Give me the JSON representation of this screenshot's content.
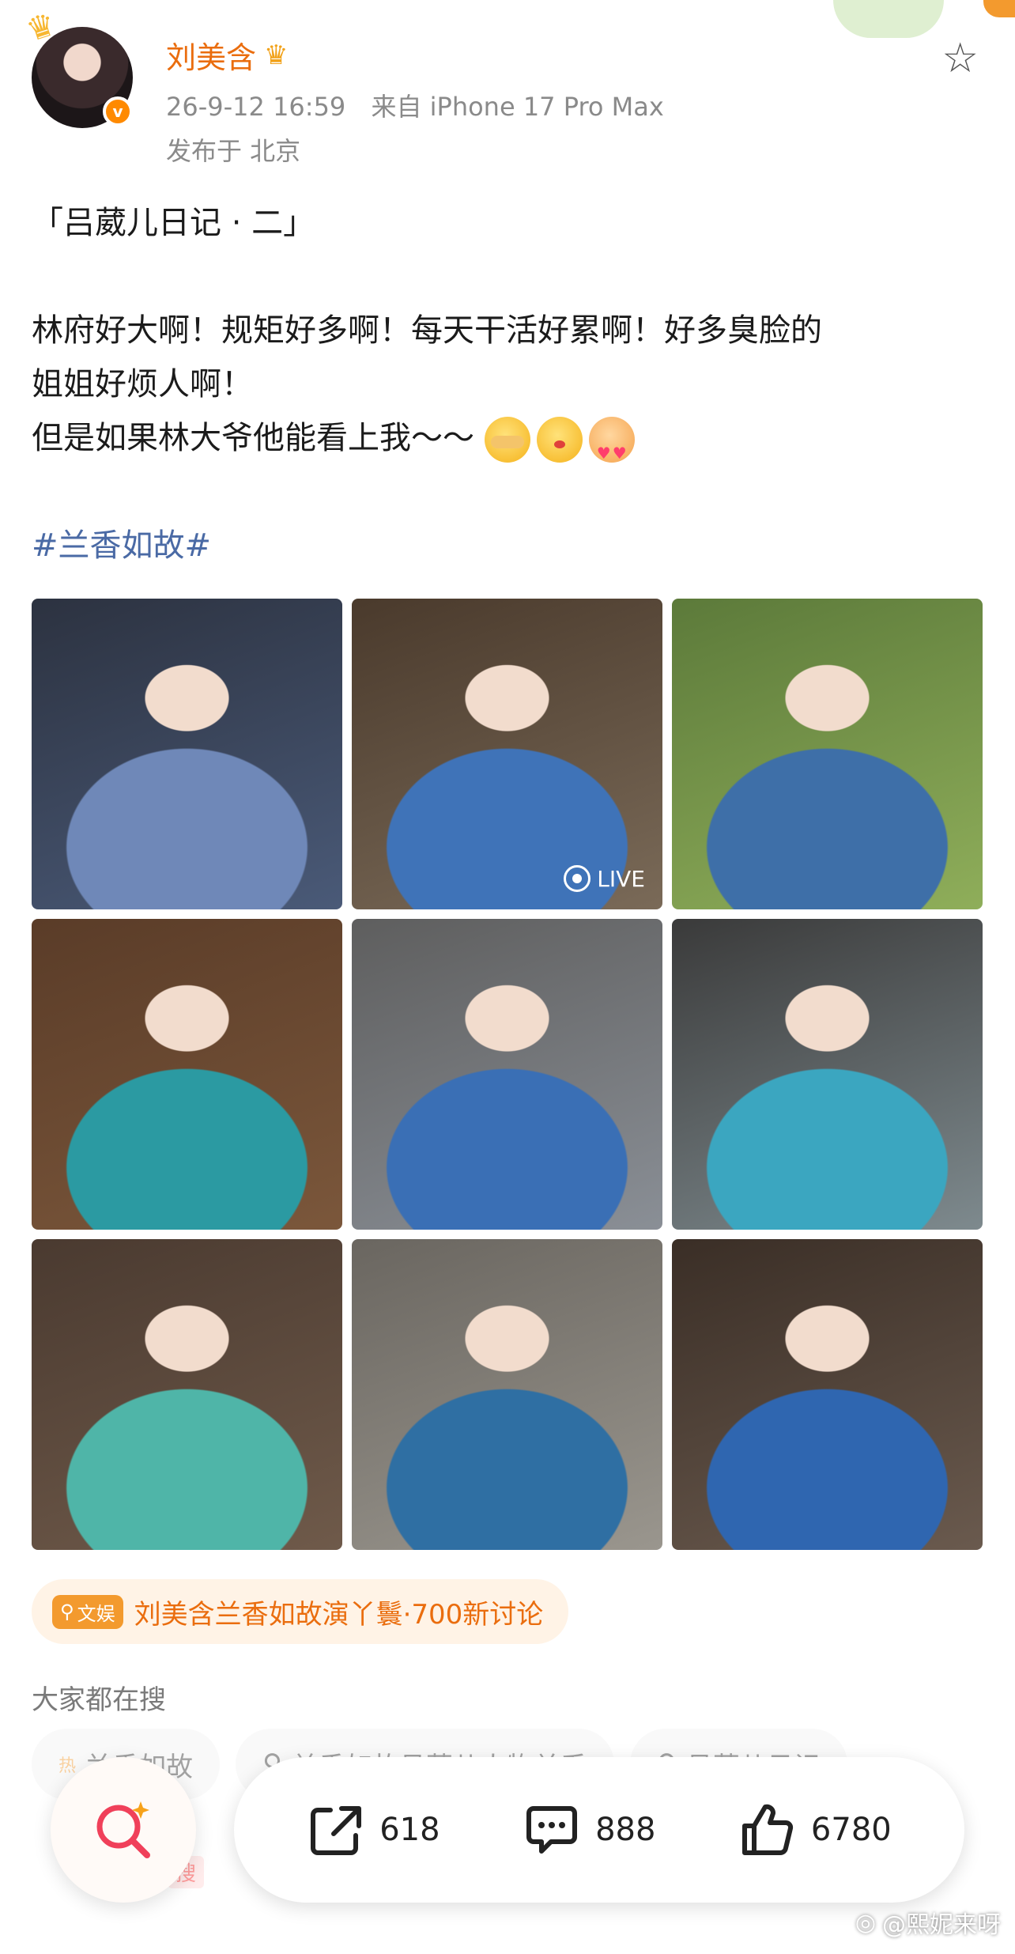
{
  "header": {
    "username": "刘美含",
    "date": "26-9-12 16:59",
    "source": "来自 iPhone 17 Pro Max",
    "location": "发布于 北京"
  },
  "post": {
    "title": "「吕葳儿日记 · 二」",
    "line1": "林府好大啊！规矩好多啊！每天干活好累啊！好多臭脸的",
    "line2": "姐姐好烦人啊！",
    "line3": "但是如果林大爷他能看上我～～",
    "hashtag": "#兰香如故#"
  },
  "photos": {
    "live_label": "LIVE",
    "items": [
      {
        "palette": [
          "#2c3240",
          "#4a5a78",
          "#6f88b8"
        ]
      },
      {
        "palette": [
          "#4a3a2c",
          "#7a6a58",
          "#3f73b8"
        ]
      },
      {
        "palette": [
          "#5c7a3a",
          "#8fae5a",
          "#3e6fa8"
        ]
      },
      {
        "palette": [
          "#5a3c28",
          "#7b573b",
          "#2b9aa2"
        ]
      },
      {
        "palette": [
          "#5e5e5e",
          "#8a8f96",
          "#3a6fb5"
        ]
      },
      {
        "palette": [
          "#3a3a3a",
          "#7e8a8e",
          "#3ba6c0"
        ]
      },
      {
        "palette": [
          "#4a3a30",
          "#6f5a4a",
          "#4fb5a8"
        ]
      },
      {
        "palette": [
          "#6a6660",
          "#9a968e",
          "#2f6fa3"
        ]
      },
      {
        "palette": [
          "#3a2e26",
          "#6a5a4e",
          "#2f66b0"
        ]
      }
    ]
  },
  "topic": {
    "tag": "文娱",
    "text": "刘美含兰香如故演丫鬟·700新讨论"
  },
  "search": {
    "heading": "大家都在搜",
    "hot": "热",
    "items": [
      "兰香如故",
      "兰香如故吕葳儿人物关系",
      "吕葳儿日记"
    ],
    "hot_tag": "搜"
  },
  "actions": {
    "share_count": "618",
    "comment_count": "888",
    "like_count": "6780"
  },
  "watermark": "@熙妮来呀",
  "colors": {
    "username": "#ea6d0e",
    "hashtag": "#4a6aa5",
    "topic_bg": "#fff3e6",
    "vip_badge": "#ff8a00"
  }
}
